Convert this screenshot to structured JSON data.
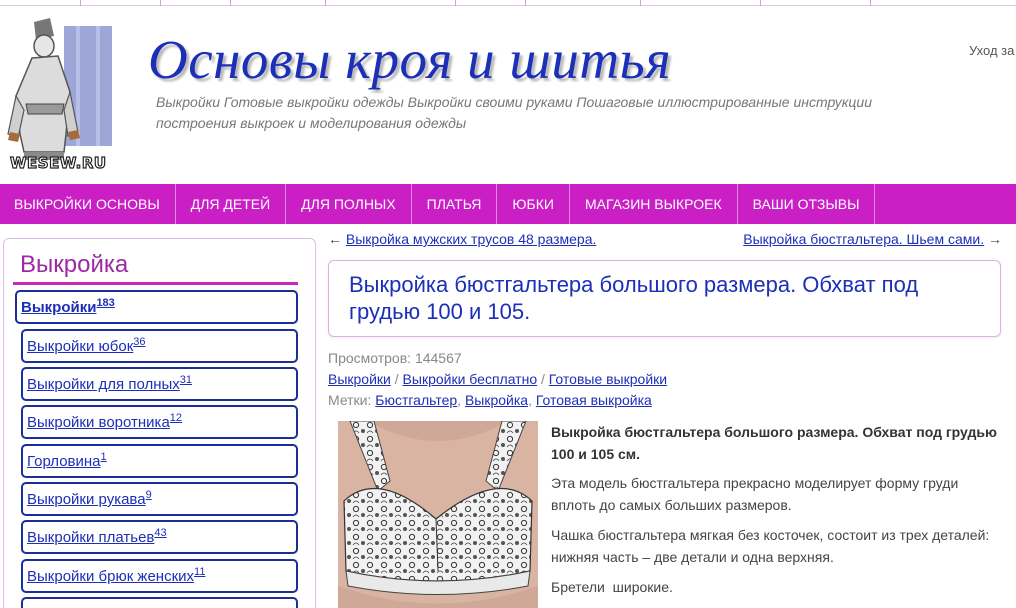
{
  "header": {
    "logo_text": "WESEW.RU",
    "title": "Основы кроя и шитья",
    "description": "Выкройки Готовые выкройки одежды Выкройки своими руками Пошаговые иллюстрированные инструкции построения выкроек и моделирования одежды",
    "right_link": "Уход за"
  },
  "nav": {
    "items": [
      "ВЫКРОЙКИ ОСНОВЫ",
      "ДЛЯ ДЕТЕЙ",
      "ДЛЯ ПОЛНЫХ",
      "ПЛАТЬЯ",
      "ЮБКИ",
      "МАГАЗИН ВЫКРОЕК",
      "ВАШИ ОТЗЫВЫ"
    ]
  },
  "sidebar": {
    "title": "Выкройка",
    "categories": [
      {
        "label": "Выкройки",
        "count": "183"
      },
      {
        "label": "Выкройки юбок",
        "count": "36"
      },
      {
        "label": "Выкройки для полных",
        "count": "31"
      },
      {
        "label": "Выкройки воротника",
        "count": "12"
      },
      {
        "label": "Горловина",
        "count": "1"
      },
      {
        "label": "Выкройки рукава",
        "count": "9"
      },
      {
        "label": "Выкройки платьев",
        "count": "43"
      },
      {
        "label": "Выкройки брюк женских",
        "count": "11"
      }
    ]
  },
  "post_nav": {
    "prev_arrow": "←",
    "prev_label": "Выкройка мужских трусов 48 размера.",
    "next_label": "Выкройка бюстгальтера. Шьем сами.",
    "next_arrow": "→"
  },
  "article": {
    "title": "Выкройка бюстгальтера большого размера. Обхват под грудью 100 и 105.",
    "views_label": "Просмотров:",
    "views_count": "144567",
    "breadcrumbs": [
      "Выкройки",
      "Выкройки бесплатно",
      "Готовые выкройки"
    ],
    "crumb_sep": "/",
    "tags_label": "Метки:",
    "tags": [
      "Бюстгальтер",
      "Выкройка",
      "Готовая выкройка"
    ],
    "tag_sep": ",",
    "lead": "Выкройка бюстгальтера большого размера. Обхват под грудью 100 и 105 см.",
    "paragraphs": [
      "Эта модель бюстгальтера прекрасно моделирует форму груди вплоть до самых больших размеров.",
      "Чашка бюстгальтера мягкая без косточек, состоит из трех деталей: нижняя часть – две детали и одна верхняя.",
      "Бретели  широкие."
    ]
  },
  "colors": {
    "accent": "#c91fc4",
    "link": "#1c2fb8",
    "sidebar_title": "#9b2aa3"
  }
}
